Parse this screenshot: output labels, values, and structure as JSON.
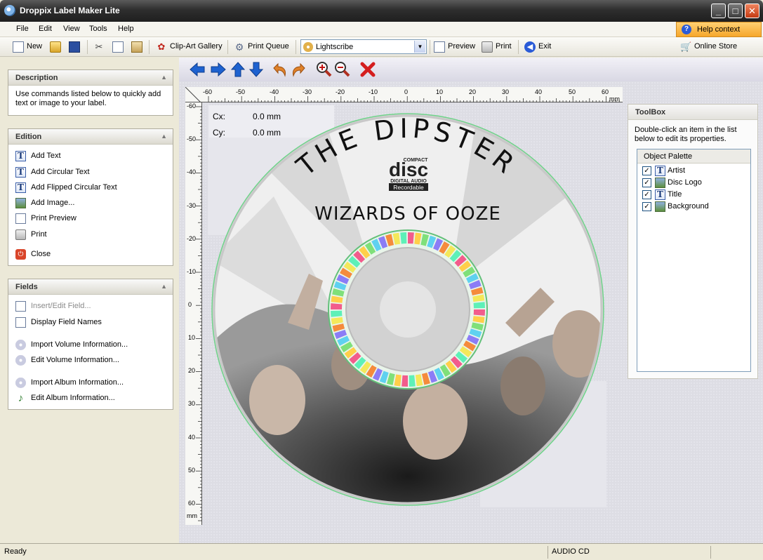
{
  "window": {
    "title": "Droppix Label Maker Lite",
    "buttons": {
      "minimize": "_",
      "maximize": "□",
      "close": "✕"
    }
  },
  "menu": {
    "items": [
      "File",
      "Edit",
      "View",
      "Tools",
      "Help"
    ],
    "help_context": "Help context",
    "help_icon": "?"
  },
  "toolbar": {
    "new": "New",
    "clipart": "Clip-Art Gallery",
    "print_queue": "Print Queue",
    "combo_value": "Lightscribe",
    "preview": "Preview",
    "print": "Print",
    "exit": "Exit",
    "online_store": "Online Store"
  },
  "description_panel": {
    "title": "Description",
    "text": "Use commands listed below to quickly add text or image to your label."
  },
  "edition_panel": {
    "title": "Edition",
    "items": [
      {
        "label": "Add Text",
        "icon": "text-icon"
      },
      {
        "label": "Add Circular Text",
        "icon": "circular-text-icon"
      },
      {
        "label": "Add Flipped Circular Text",
        "icon": "flipped-text-icon"
      },
      {
        "label": "Add Image...",
        "icon": "image-icon"
      },
      {
        "label": "Print Preview",
        "icon": "print-preview-icon"
      },
      {
        "label": "Print",
        "icon": "printer-icon"
      },
      {
        "label": "Close",
        "icon": "close-icon"
      }
    ]
  },
  "fields_panel": {
    "title": "Fields",
    "items": [
      {
        "label": "Insert/Edit Field...",
        "icon": "field-icon",
        "disabled": true
      },
      {
        "label": "Display Field Names",
        "icon": "field-names-icon"
      },
      {
        "label": "Import Volume Information...",
        "icon": "disc-icon"
      },
      {
        "label": "Edit Volume Information...",
        "icon": "disc-edit-icon"
      },
      {
        "label": "Import Album Information...",
        "icon": "disc-icon"
      },
      {
        "label": "Edit Album Information...",
        "icon": "music-note-icon"
      }
    ]
  },
  "ruler": {
    "unit": "mm",
    "h_labels": [
      "-60",
      "-50",
      "-40",
      "-30",
      "-20",
      "-10",
      "0",
      "10",
      "20",
      "30",
      "40",
      "50",
      "60"
    ],
    "v_labels": [
      "-60",
      "-50",
      "-40",
      "-30",
      "-20",
      "-10",
      "0",
      "10",
      "20",
      "30",
      "40",
      "50",
      "60"
    ]
  },
  "coords": {
    "cx_label": "Cx:",
    "cx_value": "0.0 mm",
    "cy_label": "Cy:",
    "cy_value": "0.0 mm"
  },
  "label": {
    "artist": "THE DIPSTER",
    "title": "WIZARDS OF OOZE",
    "logo": {
      "top": "COMPACT",
      "main": "disc",
      "sub": "DIGITAL AUDIO",
      "badge": "Recordable"
    }
  },
  "toolbox": {
    "title": "ToolBox",
    "description": "Double-click an item in the list below to edit its properties.",
    "palette_header": "Object Palette",
    "items": [
      {
        "label": "Artist",
        "checked": true,
        "icon": "text-icon"
      },
      {
        "label": "Disc Logo",
        "checked": true,
        "icon": "image-icon"
      },
      {
        "label": "Title",
        "checked": true,
        "icon": "text-icon"
      },
      {
        "label": "Background",
        "checked": true,
        "icon": "image-icon"
      }
    ]
  },
  "status": {
    "left": "Ready",
    "right": "AUDIO CD"
  },
  "colors": {
    "accent": "#f6a72b",
    "nav_blue": "#1e62d0",
    "undo_orange": "#e0822a",
    "delete_red": "#d41e1e"
  }
}
